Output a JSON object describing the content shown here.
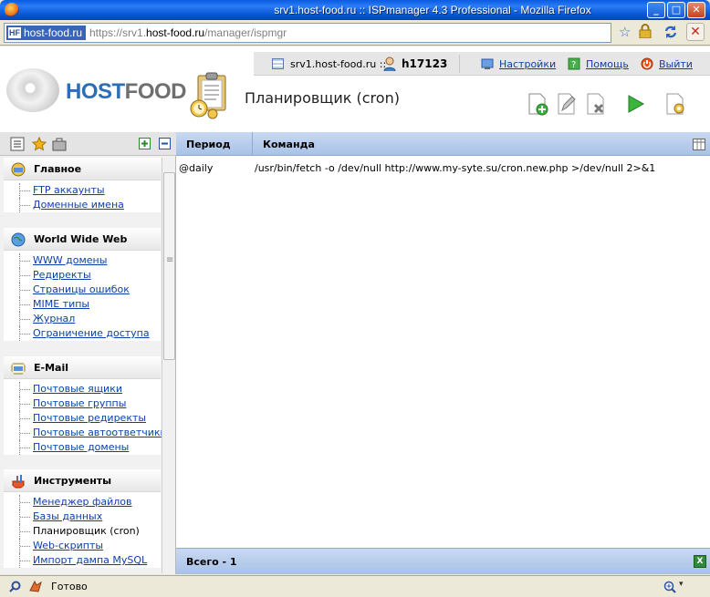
{
  "window": {
    "title": "srv1.host-food.ru :: ISPmanager 4.3 Professional - Mozilla Firefox",
    "minimize": "_",
    "maximize": "□",
    "close": "✕"
  },
  "address": {
    "site_identity": "host-food.ru",
    "site_badge": "HF",
    "url_scheme": "https://srv1.",
    "url_domain": "host-food.ru",
    "url_path": "/manager/ispmgr"
  },
  "header": {
    "logo_host": "HOST",
    "logo_food": "FOOD",
    "page_title": "Планировщик (cron)",
    "server": "srv1.host-food.ru ::",
    "user": "h17123",
    "links": {
      "settings": "Настройки",
      "help": "Помощь",
      "logout": "Выйти"
    }
  },
  "sidebar": {
    "groups": [
      {
        "title": "Главное",
        "items": [
          "FTP аккаунты",
          "Доменные имена"
        ]
      },
      {
        "title": "World Wide Web",
        "items": [
          "WWW домены",
          "Редиректы",
          "Страницы ошибок",
          "MIME типы",
          "Журнал",
          "Ограничение доступа"
        ]
      },
      {
        "title": "E-Mail",
        "items": [
          "Почтовые ящики",
          "Почтовые группы",
          "Почтовые редиректы",
          "Почтовые автоответчики",
          "Почтовые домены"
        ]
      },
      {
        "title": "Инструменты",
        "items": [
          "Менеджер файлов",
          "Базы данных",
          "Планировщик (cron)",
          "Web-скрипты",
          "Импорт дампа MySQL"
        ]
      }
    ]
  },
  "table": {
    "columns": [
      "Период",
      "Команда"
    ],
    "rows": [
      {
        "period": "@daily",
        "command": "/usr/bin/fetch -o /dev/null http://www.my-syte.su/cron.new.php >/dev/null 2>&1"
      }
    ],
    "footer": "Всего - 1"
  },
  "status": {
    "text": "Готово"
  },
  "colors": {
    "accent": "#2c6fb6",
    "link": "#0d3fa8",
    "table_header": "#b8cdee"
  }
}
